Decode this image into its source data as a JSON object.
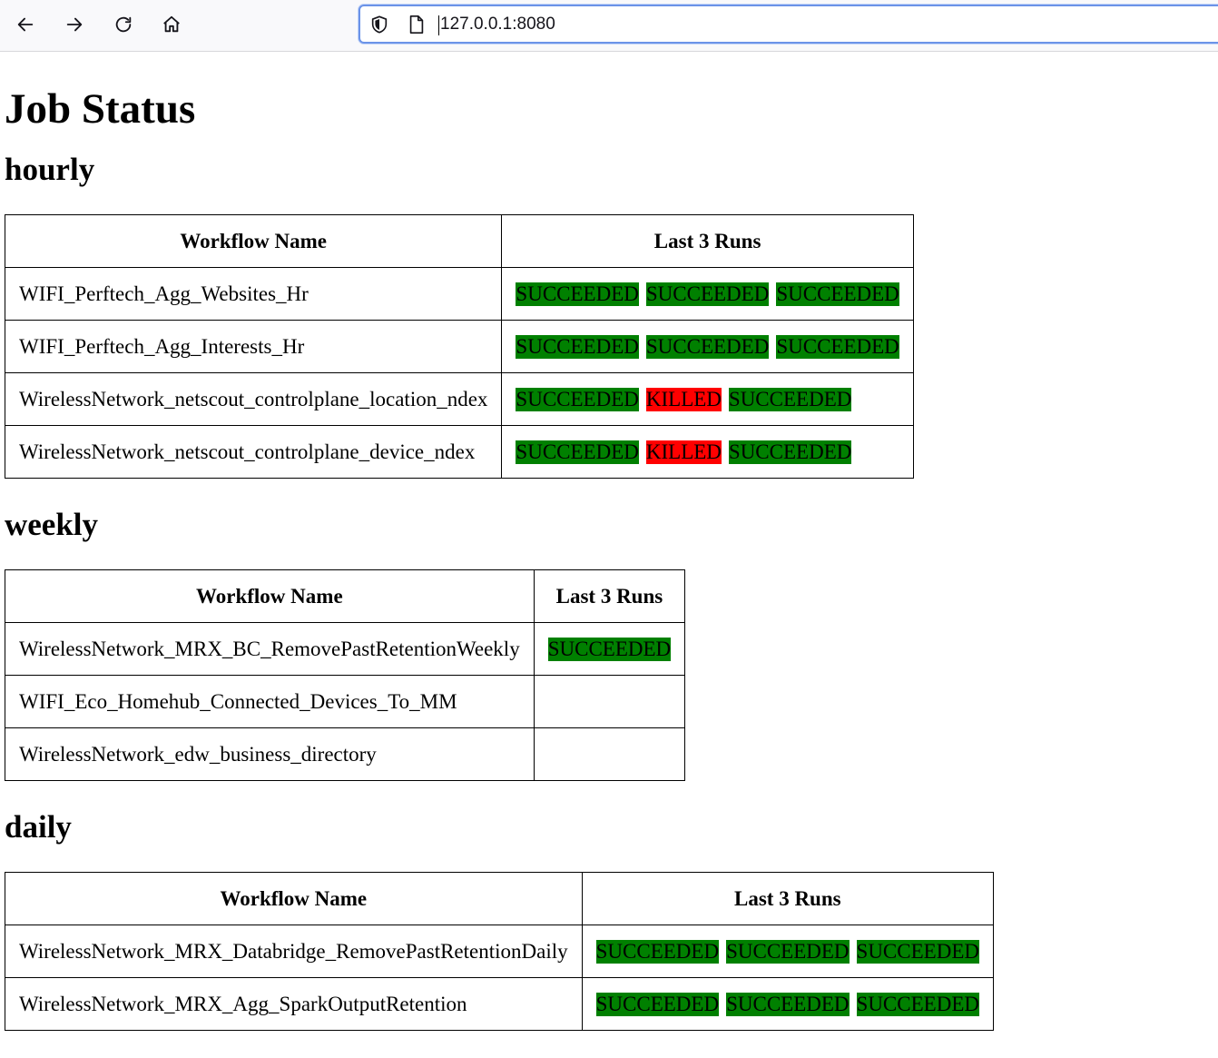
{
  "browser": {
    "url": "127.0.0.1:8080"
  },
  "page": {
    "title": "Job Status"
  },
  "sections": [
    {
      "heading": "hourly",
      "columns": [
        "Workflow Name",
        "Last 3 Runs"
      ],
      "rows": [
        {
          "name": "WIFI_Perftech_Agg_Websites_Hr",
          "runs": [
            "SUCCEEDED",
            "SUCCEEDED",
            "SUCCEEDED"
          ]
        },
        {
          "name": "WIFI_Perftech_Agg_Interests_Hr",
          "runs": [
            "SUCCEEDED",
            "SUCCEEDED",
            "SUCCEEDED"
          ]
        },
        {
          "name": "WirelessNetwork_netscout_controlplane_location_ndex",
          "runs": [
            "SUCCEEDED",
            "KILLED",
            "SUCCEEDED"
          ]
        },
        {
          "name": "WirelessNetwork_netscout_controlplane_device_ndex",
          "runs": [
            "SUCCEEDED",
            "KILLED",
            "SUCCEEDED"
          ]
        }
      ]
    },
    {
      "heading": "weekly",
      "columns": [
        "Workflow Name",
        "Last 3 Runs"
      ],
      "rows": [
        {
          "name": "WirelessNetwork_MRX_BC_RemovePastRetentionWeekly",
          "runs": [
            "SUCCEEDED"
          ]
        },
        {
          "name": "WIFI_Eco_Homehub_Connected_Devices_To_MM",
          "runs": []
        },
        {
          "name": "WirelessNetwork_edw_business_directory",
          "runs": []
        }
      ]
    },
    {
      "heading": "daily",
      "columns": [
        "Workflow Name",
        "Last 3 Runs"
      ],
      "rows": [
        {
          "name": "WirelessNetwork_MRX_Databridge_RemovePastRetentionDaily",
          "runs": [
            "SUCCEEDED",
            "SUCCEEDED",
            "SUCCEEDED"
          ]
        },
        {
          "name": "WirelessNetwork_MRX_Agg_SparkOutputRetention",
          "runs": [
            "SUCCEEDED",
            "SUCCEEDED",
            "SUCCEEDED"
          ]
        }
      ]
    }
  ],
  "status_colors": {
    "SUCCEEDED": "#008000",
    "KILLED": "#ff0000"
  },
  "icons": {
    "back": "arrow-left-icon",
    "forward": "arrow-right-icon",
    "reload": "reload-icon",
    "home": "home-icon",
    "shield": "shield-icon",
    "page": "page-icon"
  }
}
